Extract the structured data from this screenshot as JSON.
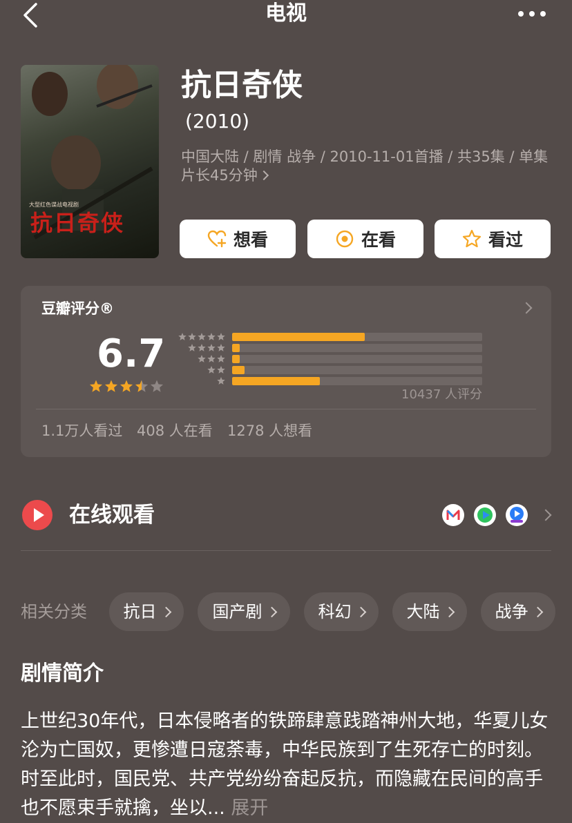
{
  "header": {
    "title": "电视"
  },
  "show": {
    "title": "抗日奇侠",
    "year": "(2010)",
    "meta": "中国大陆 / 剧情 战争 / 2010-11-01首播 / 共35集 / 单集片长45分钟",
    "poster_title": "抗日奇侠",
    "poster_subtitle": "大型红色谍战电视剧"
  },
  "actions": [
    {
      "label": "想看",
      "icon": "heart-plus-icon"
    },
    {
      "label": "在看",
      "icon": "target-icon"
    },
    {
      "label": "看过",
      "icon": "star-outline-icon"
    }
  ],
  "rating": {
    "title": "豆瓣评分®",
    "score": "6.7",
    "stars_value": 3.5,
    "distribution": [
      {
        "stars": 5,
        "percent": 53
      },
      {
        "stars": 4,
        "percent": 3
      },
      {
        "stars": 3,
        "percent": 3
      },
      {
        "stars": 2,
        "percent": 5
      },
      {
        "stars": 1,
        "percent": 35
      }
    ],
    "count_text": "10437 人评分",
    "stats": [
      "1.1万人看过",
      "408 人在看",
      "1278 人想看"
    ]
  },
  "online": {
    "label": "在线观看",
    "platforms": [
      "mango-tv-icon",
      "iqiyi-icon",
      "youku-icon"
    ]
  },
  "categories": {
    "label": "相关分类",
    "items": [
      "抗日",
      "国产剧",
      "科幻",
      "大陆",
      "战争"
    ]
  },
  "synopsis": {
    "title": "剧情简介",
    "text": "上世纪30年代，日本侵略者的铁蹄肆意践踏神州大地，华夏儿女沦为亡国奴，更惨遭日寇荼毒，中华民族到了生死存亡的时刻。时至此时，国民党、共产党纷纷奋起反抗，而隐藏在民间的高手也不愿束手就擒，坐以...",
    "more": "展开"
  },
  "colors": {
    "background": "#534b49",
    "accent": "#f5a623",
    "play": "#ec4a4c"
  }
}
